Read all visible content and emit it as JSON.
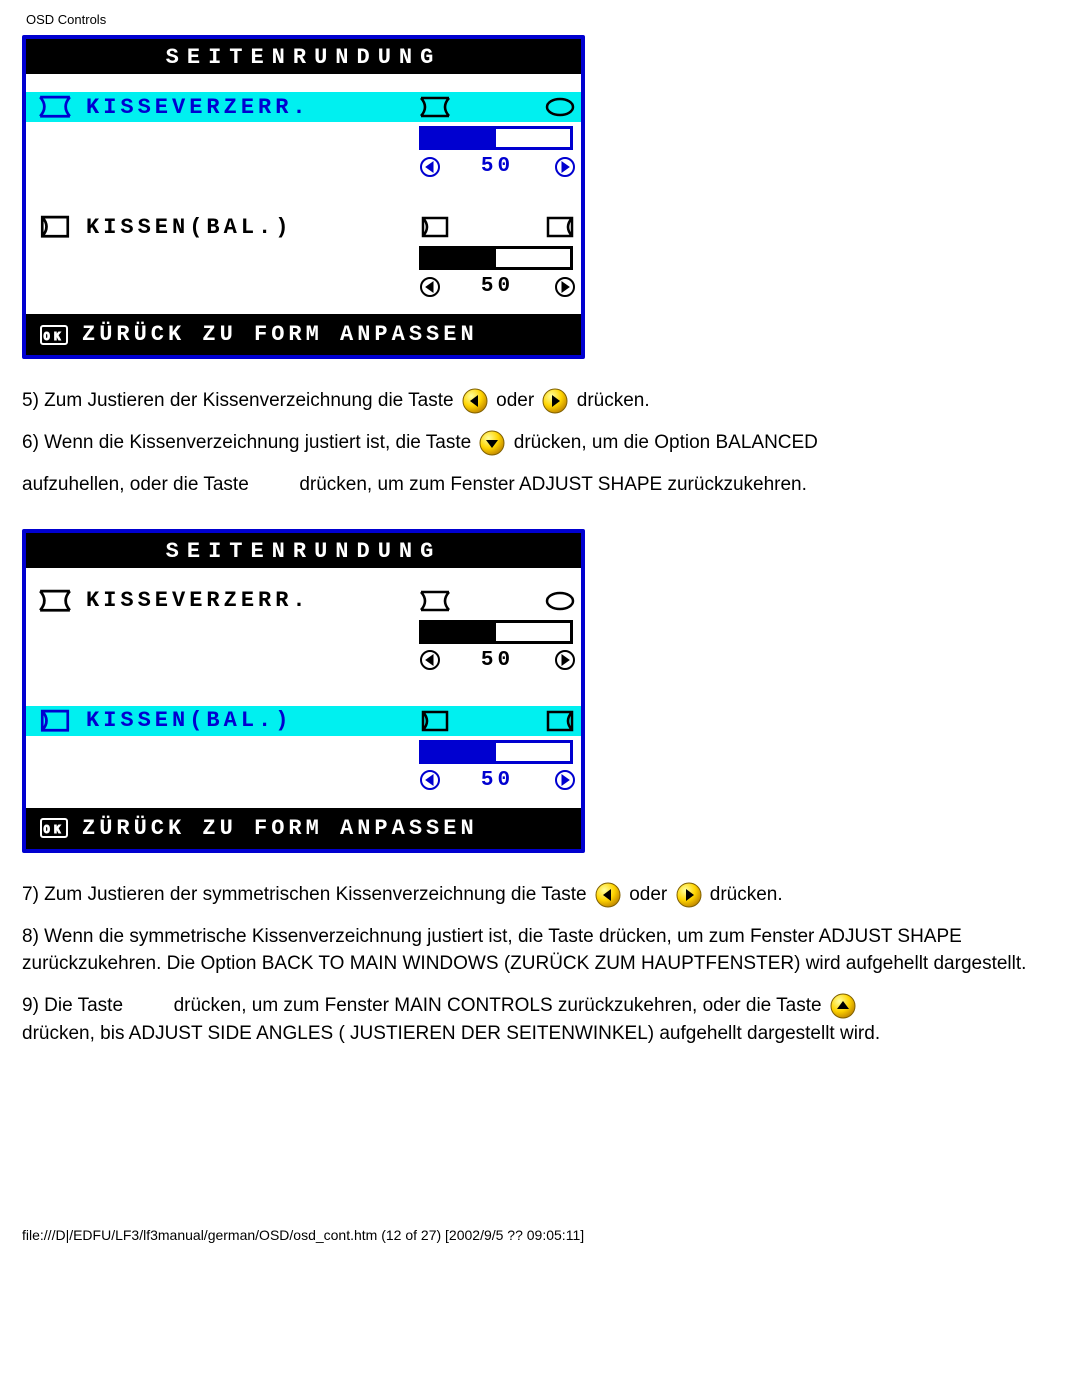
{
  "page_header": "OSD Controls",
  "osd1": {
    "title": "SEITENRUNDUNG",
    "row1_label": "KISSEVERZERR.",
    "row1_value": "50",
    "row2_label": "KISSEN(BAL.)",
    "row2_value": "50",
    "footer": "ZÜRÜCK ZU FORM ANPASSEN"
  },
  "osd2": {
    "title": "SEITENRUNDUNG",
    "row1_label": "KISSEVERZERR.",
    "row1_value": "50",
    "row2_label": "KISSEN(BAL.)",
    "row2_value": "50",
    "footer": "ZÜRÜCK ZU FORM ANPASSEN"
  },
  "instructions": {
    "p5a": "5) Zum Justieren der Kissenverzeichnung die Taste ",
    "p5b": " oder ",
    "p5c": " drücken.",
    "p6a": "6) Wenn die Kissenverzeichnung justiert ist, die Taste ",
    "p6b": " drücken, um die Option BALANCED",
    "p6c": "aufzuhellen, oder die Taste ",
    "p6d": " drücken, um zum Fenster ADJUST SHAPE zurückzukehren.",
    "p7a": "7) Zum Justieren der symmetrischen Kissenverzeichnung die Taste ",
    "p7b": " oder ",
    "p7c": " drücken.",
    "p8": "8) Wenn die symmetrische Kissenverzeichnung justiert ist, die Taste         drücken, um zum Fenster ADJUST SHAPE zurückzukehren. Die Option BACK TO MAIN WINDOWS (ZURÜCK ZUM HAUPTFENSTER) wird aufgehellt dargestellt.",
    "p9a": "9) Die Taste ",
    "p9b": " drücken, um zum Fenster MAIN CONTROLS zurückzukehren, oder die Taste ",
    "p9c": "drücken, bis ADJUST SIDE ANGLES ( JUSTIEREN DER SEITENWINKEL) aufgehellt dargestellt wird."
  },
  "footer_path": "file:///D|/EDFU/LF3/lf3manual/german/OSD/osd_cont.htm (12 of 27) [2002/9/5 ?? 09:05:11]"
}
